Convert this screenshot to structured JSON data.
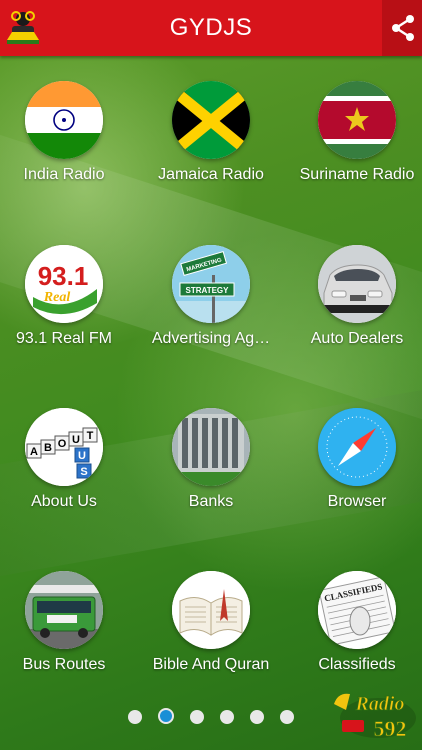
{
  "header": {
    "title": "GYDJS",
    "share_icon": "share-icon",
    "logo_icon": "dj-logo-icon"
  },
  "tiles": [
    {
      "label": "India Radio",
      "icon": "india-flag-icon"
    },
    {
      "label": "Jamaica Radio",
      "icon": "jamaica-flag-icon"
    },
    {
      "label": "Suriname Radio",
      "icon": "suriname-flag-icon"
    },
    {
      "label": "93.1 Real FM",
      "icon": "real-fm-logo-icon",
      "logo_text": "93.1",
      "logo_sub": "Real"
    },
    {
      "label": "Advertising Ag…",
      "icon": "marketing-strategy-sign-icon",
      "sign_top": "MARKETING",
      "sign_bottom": "STRATEGY"
    },
    {
      "label": "Auto Dealers",
      "icon": "car-icon"
    },
    {
      "label": "About Us",
      "icon": "about-us-blocks-icon",
      "blocks": [
        "A",
        "B",
        "O",
        "U",
        "T",
        "U",
        "S"
      ]
    },
    {
      "label": "Banks",
      "icon": "bank-building-icon"
    },
    {
      "label": "Browser",
      "icon": "compass-icon"
    },
    {
      "label": "Bus Routes",
      "icon": "bus-icon"
    },
    {
      "label": "Bible And Quran",
      "icon": "open-book-icon"
    },
    {
      "label": "Classifieds",
      "icon": "classifieds-newspaper-icon",
      "paper_text": "CLASSIFIEDS"
    }
  ],
  "pagination": {
    "count": 6,
    "active_index": 1
  },
  "brand": {
    "name": "Radio",
    "number": "592",
    "icon": "radio-592-logo-icon"
  },
  "colors": {
    "header": "#d7141b",
    "share_bg": "#b80f15",
    "dot_active": "#1a8fd6",
    "dot": "#e8e8e8"
  }
}
